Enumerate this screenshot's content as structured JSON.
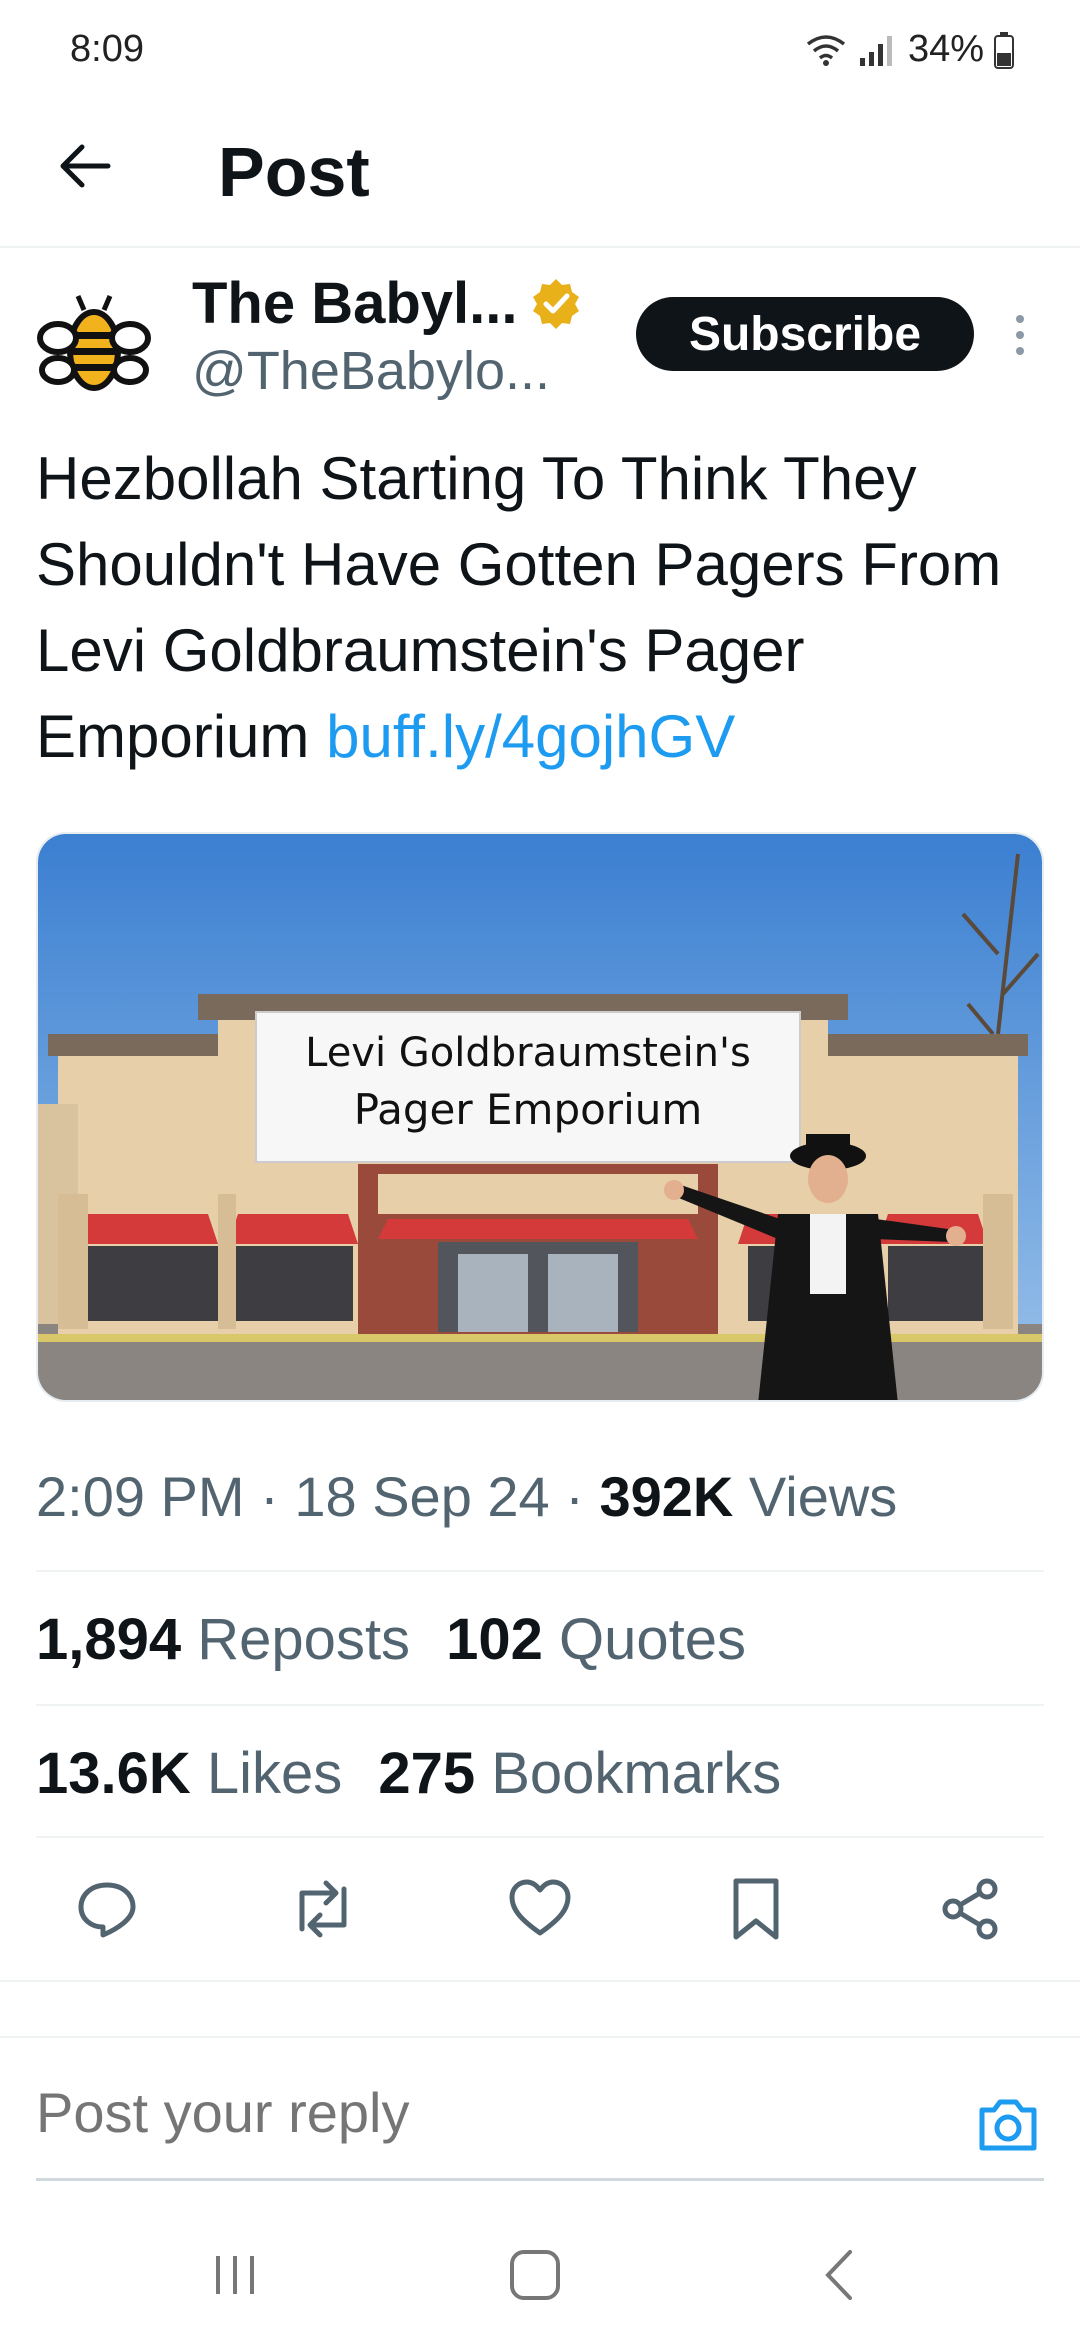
{
  "status_bar": {
    "time": "8:09",
    "battery": "34%"
  },
  "header": {
    "title": "Post"
  },
  "author": {
    "display_name": "The Babyl...",
    "handle": "@TheBabylo...",
    "verified": true
  },
  "subscribe": {
    "label": "Subscribe"
  },
  "post": {
    "text": "Hezbollah Starting To Think They Shouldn't Have Gotten Pagers From Levi Goldbraumstein's Pager Emporium",
    "link": "buff.ly/4gojhGV"
  },
  "media": {
    "sign_line1": "Levi Goldbraumstein's",
    "sign_line2": "Pager Emporium"
  },
  "meta": {
    "time": "2:09 PM",
    "separator": "·",
    "date": "18 Sep 24",
    "views_count": "392K",
    "views_label": "Views"
  },
  "stats": {
    "reposts_count": "1,894",
    "reposts_label": "Reposts",
    "quotes_count": "102",
    "quotes_label": "Quotes",
    "likes_count": "13.6K",
    "likes_label": "Likes",
    "bookmarks_count": "275",
    "bookmarks_label": "Bookmarks"
  },
  "actions": [
    "reply-icon",
    "repost-icon",
    "like-icon",
    "bookmark-icon",
    "share-icon"
  ],
  "reply": {
    "placeholder": "Post your reply"
  },
  "colors": {
    "link": "#1d9bf0",
    "text": "#0f1419",
    "muted": "#536471",
    "verified": "#e8b019",
    "subscribe_bg": "#0f1419"
  }
}
